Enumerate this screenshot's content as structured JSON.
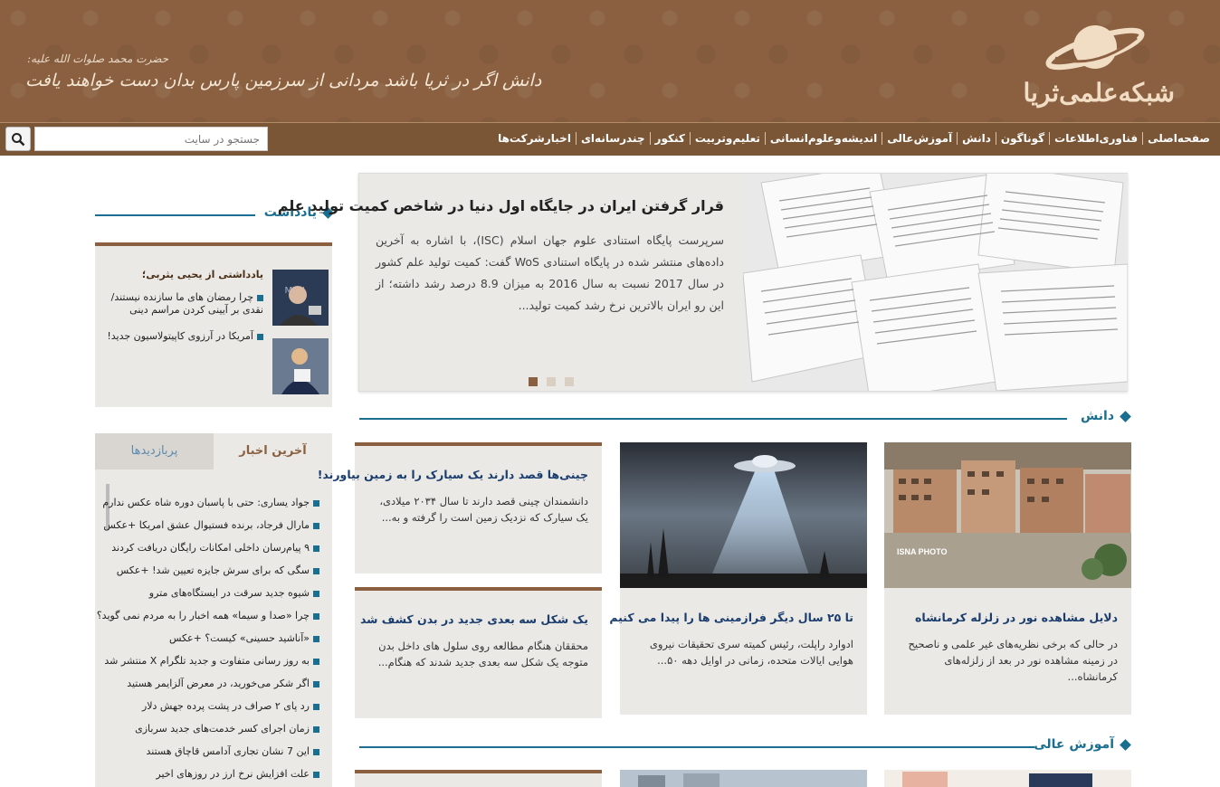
{
  "header": {
    "logo_text": "شبکه‌علمی‌ثریا",
    "quote_attribution": "حضرت محمد صلوات الله علیه:",
    "quote": "دانش اگر در ثریا باشد مردانی از سرزمین پارس بدان دست خواهند یافت",
    "brand_color": "#8a6040",
    "accent_color": "#1a6f91"
  },
  "nav": {
    "items": [
      "صفحه‌اصلی",
      "فناوری‌اطلاعات",
      "گوناگون",
      "دانش",
      "آموزش‌عالی",
      "اندیشه‌وعلوم‌انسانی",
      "تعلیم‌وتربیت",
      "کنکور",
      "چندرسانه‌ای",
      "اخبار‌شرکت‌ها"
    ],
    "search_placeholder": "جستجو در سایت",
    "search_icon": "search-icon"
  },
  "yaddasht": {
    "title": "یادداشت",
    "author": "یادداشتی از یحیی یثربی؛",
    "items": [
      "چرا رمضان های ما سازنده نیستند/ نقدی بر آیینی کردن مراسم دینی",
      "آمریکا در آرزوی کاپیتولاسیون جدید!"
    ]
  },
  "slider": {
    "title": "قرار گرفتن ایران در جایگاه اول دنیا در شاخص کمیت تولید علم",
    "text": "سرپرست پایگاه استنادی علوم جهان اسلام (ISC)، با اشاره به آخرین داده‌های منتشر شده در پایگاه استنادی WoS گفت: کمیت تولید علم کشور در سال 2017 نسبت به سال 2016 به میزان 8.9 درصد رشد داشته؛ از این رو ایران بالاترین نرخ رشد کمیت تولید...",
    "active_dot": 3
  },
  "tabs": {
    "latest": "آخرین اخبار",
    "popular": "پربازدیدها"
  },
  "latest_news": [
    "جواد یساری: حتی با پاسبان دوره شاه عکس ندارم",
    "مارال فرجاد، برنده فستیوال عشق امریکا +عکس",
    "۹ پیام‌رسان داخلی امکانات رایگان دریافت کردند",
    "سگی که برای سرش جایزه تعیین شد! +عکس",
    "شیوه جدید سرقت در ایستگاه‌های مترو",
    "چرا «صدا و سیما» همه اخبار را به مردم نمی گوید؟",
    "«آناشید حسینی» کیست؟ +عکس",
    "به روز رسانی متفاوت و جدید تلگرام X منتشر شد",
    "اگر شکر می‌خورید، در معرض آلزایمر هستید",
    "رد پای ۲ صراف در پشت پرده جهش دلار",
    "زمان اجرای کسر خدمت‌های جدید سربازی",
    "این 7 نشان تجاری آدامس قاچاق هستند",
    "علت افزایش نرخ ارز در روزهای اخیر"
  ],
  "sections": {
    "danesh": "دانش",
    "amoozesh": "آموزش عالی"
  },
  "cards": [
    {
      "title": "دلایل مشاهده نور در زلزله کرمانشاه",
      "text": "در حالی که برخی نظریه‌های غیر علمی و ناصحیح در زمینه مشاهده نور در بعد از زلزله‌های کرمانشاه...",
      "watermark": "ISNA PHOTO"
    },
    {
      "title": "تا ۲۵ سال دیگر فرازمینی ها را پیدا می کنیم",
      "text": "ادوارد راپلت، رئیس کمیته سری تحقیقات نیروی هوایی ایالات متحده، زمانی در اوایل دهه ۵۰..."
    },
    {
      "title": "چینی‌ها قصد دارند یک سیارک را به زمین بیاورند!",
      "text": "دانشمندان چینی قصد دارند تا سال ۲۰۳۴ میلادی، یک سیارک که نزدیک زمین است را گرفته و به..."
    },
    {
      "title": "یک شکل سه بعدی جدید در بدن کشف شد",
      "text": "محققان هنگام مطالعه روی سلول های داخل بدن متوجه یک شکل سه بعدی جدید شدند که هنگام..."
    }
  ]
}
